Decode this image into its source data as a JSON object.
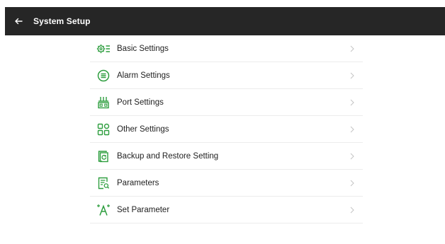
{
  "header": {
    "title": "System Setup",
    "back_icon": "arrow-left-icon"
  },
  "colors": {
    "header_bg": "#262626",
    "accent": "#2e9e3f"
  },
  "menu": [
    {
      "label": "Basic Settings",
      "icon": "settings-gear-icon"
    },
    {
      "label": "Alarm Settings",
      "icon": "alarm-list-icon"
    },
    {
      "label": "Port Settings",
      "icon": "port-icon"
    },
    {
      "label": "Other Settings",
      "icon": "grid-apps-icon"
    },
    {
      "label": "Backup and Restore Setting",
      "icon": "backup-restore-icon"
    },
    {
      "label": "Parameters",
      "icon": "document-parameters-icon"
    },
    {
      "label": "Set Parameter",
      "icon": "set-parameter-icon"
    }
  ]
}
